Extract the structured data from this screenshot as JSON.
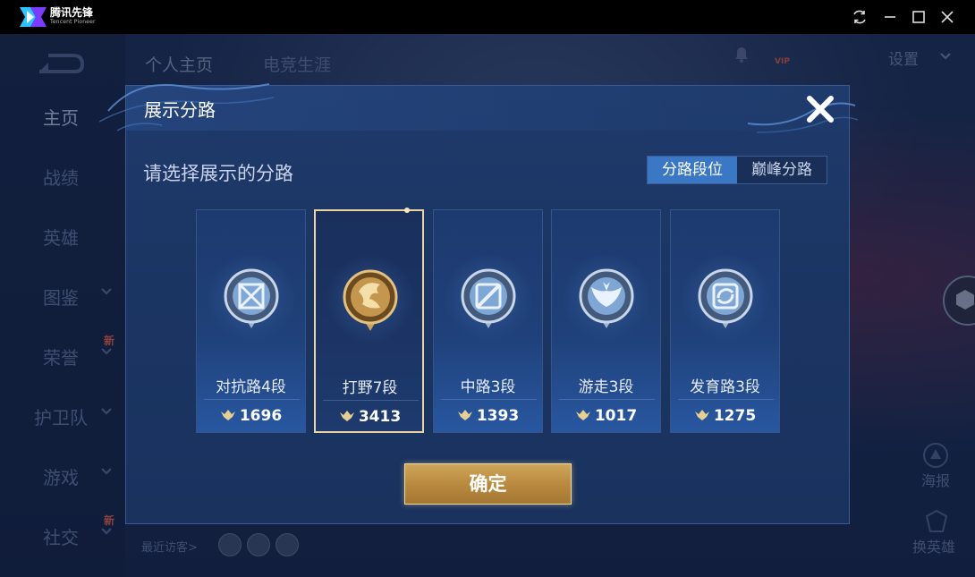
{
  "window": {
    "app_name": "腾讯先锋",
    "app_subtitle": "Tencent Pioneer",
    "buttons": [
      "refresh-icon",
      "minimize-icon",
      "maximize-icon",
      "close-icon"
    ]
  },
  "game": {
    "top_tabs": [
      "个人主页",
      "电竞生涯"
    ],
    "settings_label": "设置",
    "vip_badge": "VIP",
    "nav": [
      {
        "label": "主页",
        "active": true,
        "chevron": false,
        "new": false
      },
      {
        "label": "战绩",
        "active": false,
        "chevron": false,
        "new": false
      },
      {
        "label": "英雄",
        "active": false,
        "chevron": false,
        "new": false
      },
      {
        "label": "图鉴",
        "active": false,
        "chevron": true,
        "new": false
      },
      {
        "label": "荣誉",
        "active": false,
        "chevron": true,
        "new": true
      },
      {
        "label": "护卫队",
        "active": false,
        "chevron": true,
        "new": false
      },
      {
        "label": "游戏",
        "active": false,
        "chevron": true,
        "new": false
      },
      {
        "label": "社交",
        "active": false,
        "chevron": true,
        "new": true
      }
    ],
    "new_badge": "新",
    "recent_visitors_label": "最近访客>",
    "side_buttons": {
      "poster": "海报",
      "change_hero": "换英雄"
    }
  },
  "modal": {
    "title": "展示分路",
    "subtitle": "请选择展示的分路",
    "segmented": {
      "active": "分路段位",
      "inactive": "巅峰分路"
    },
    "lanes": [
      {
        "name": "对抗路4段",
        "score": "1696",
        "emblem": "crossed-swords-emblem-icon",
        "selected": false
      },
      {
        "name": "打野7段",
        "score": "3413",
        "emblem": "dragon-emblem-icon",
        "selected": true
      },
      {
        "name": "中路3段",
        "score": "1393",
        "emblem": "mid-lane-slash-emblem-icon",
        "selected": false
      },
      {
        "name": "游走3段",
        "score": "1017",
        "emblem": "roam-wings-emblem-icon",
        "selected": false
      },
      {
        "name": "发育路3段",
        "score": "1275",
        "emblem": "farm-lane-arrows-emblem-icon",
        "selected": false
      }
    ],
    "confirm_label": "确定"
  },
  "colors": {
    "modal_bg": "#1b3563",
    "accent_blue": "#3a78c6",
    "gold": "#c69a4e",
    "selected_border": "#e9d4a2"
  }
}
